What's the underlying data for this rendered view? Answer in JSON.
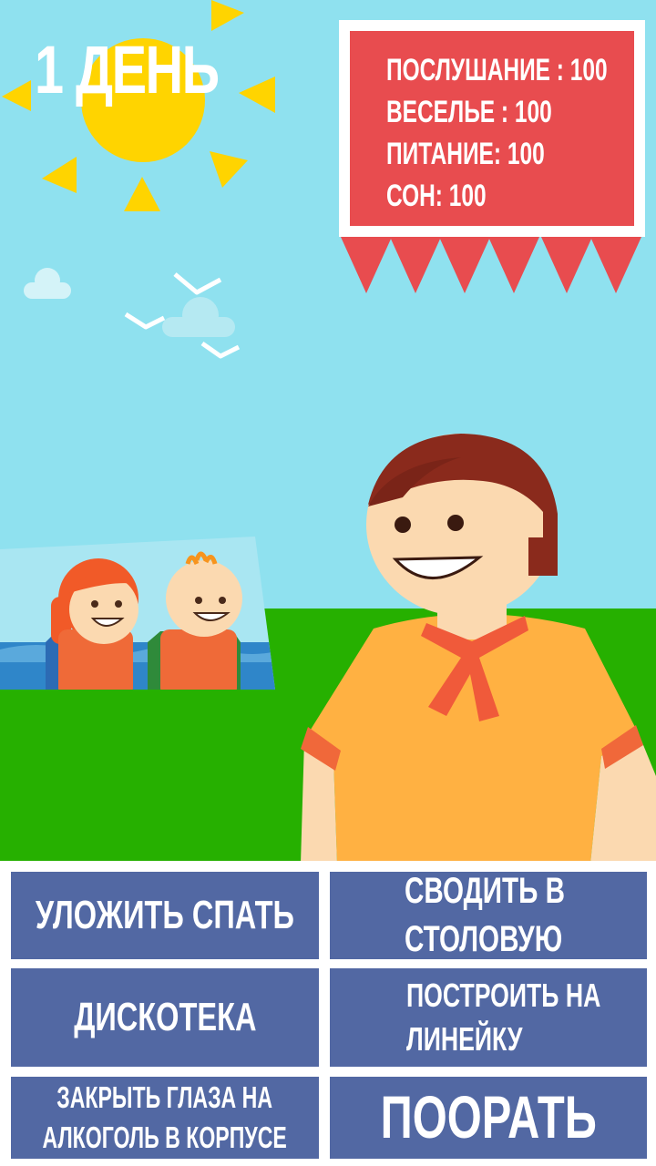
{
  "hud": {
    "day_label": "1 ДЕНЬ"
  },
  "stats": [
    {
      "label": "ПОСЛУШАНИЕ : 100"
    },
    {
      "label": "ВЕСЕЛЬЕ : 100"
    },
    {
      "label": "ПИТАНИЕ: 100"
    },
    {
      "label": "СОН: 100"
    }
  ],
  "actions": {
    "sleep": "УЛОЖИТЬ СПАТЬ",
    "canteen_line1": "СВОДИТЬ В",
    "canteen_line2": "СТОЛОВУЮ",
    "disco": "ДИСКОТЕКА",
    "lineup_line1": "ПОСТРОИТЬ НА",
    "lineup_line2": "ЛИНЕЙКУ",
    "alcohol_line1": "ЗАКРЫТЬ ГЛАЗА НА",
    "alcohol_line2": "АЛКОГОЛЬ В КОРПУСЕ",
    "yell": "ПООРАТЬ"
  },
  "colors": {
    "sky": "#8fe1ef",
    "grass": "#26b000",
    "stats_panel": "#e84c4f",
    "button": "#5268a3",
    "sun": "#ffd400",
    "shirt": "#ffb142",
    "neckerchief": "#f05a3a"
  }
}
